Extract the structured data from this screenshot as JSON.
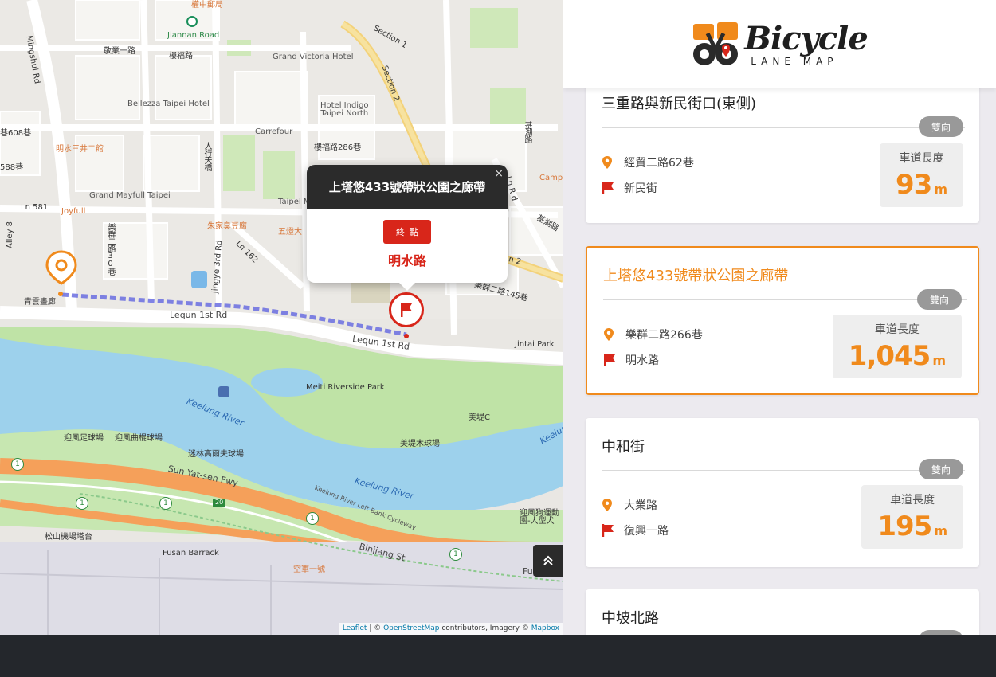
{
  "map": {
    "labels": {
      "jiannan_road": "Jiannan Road",
      "section_1": "Section 1",
      "section_2": "Section 2",
      "minghsui_rd": "Mingshui Rd",
      "jingye_1st": "敬業一路",
      "jingfu_rd": "樓福路",
      "grand_victoria": "Grand Victoria Hotel",
      "bellezza": "Bellezza Taipei Hotel",
      "hotel_indigo": "Hotel Indigo\nTaipei North",
      "carrefour": "Carrefour",
      "lane_286": "樓福路286巷",
      "jihu_rd": "基湖路",
      "ln_608": "巷608巷",
      "ln_588": "588巷",
      "mingshui_sanjing": "明水三井二館",
      "grand_mayfull": "Grand Mayfull Taipei",
      "joyfull": "Joyfull",
      "ln_581": "Ln 581",
      "alley_8": "Alley 8",
      "lequn_2nd_30": "樂群二路30巷",
      "jingye_3rd": "Jingye 3rd Rd",
      "renxing_st": "人行天橋",
      "zhujia": "朱家臭豆腐",
      "ln_162": "Ln 162",
      "wuyi": "五燈大",
      "taipei_m": "Taipei M",
      "camp": "Camp",
      "jihu_rd2": "基湖路",
      "lequn_2nd_145": "樂群二路145巷",
      "n2": "n 2",
      "jinjing_gallery": "青雲畫廊",
      "lequn_1st_a": "Lequn 1st Rd",
      "lequn_1st_b": "Lequn 1st Rd",
      "jintai_park": "Jintai Park",
      "meiti_park": "Meiti Riverside Park",
      "keelung_river_a": "Keelung River",
      "keelung_river_b": "Keelung River",
      "keelung_r": "Keelun",
      "meti_c": "美堤C",
      "meti_softball": "美堤木球場",
      "yingfeng_soccer": "迎風足球場",
      "yingfeng_hockey": "迎風曲棍球場",
      "mini_golf": "迷林高爾夫球場",
      "sun_yatsen_fwy": "Sun Yat-sen Fwy",
      "cycleway": "Keelung River Left Bank Cycleway",
      "songshan_tower": "松山機場塔台",
      "fusan_barrack": "Fusan Barrack",
      "binjiang_st": "Binjiang St",
      "fuyuan": "Fuyuan",
      "kongjun": "空軍一號",
      "dog_park": "迎風狗運動\n園-大型犬",
      "fwy_20": "20",
      "shield_1": "1"
    },
    "attribution": {
      "leaflet": "Leaflet",
      "sep": " | © ",
      "osm": "OpenStreetMap",
      "mid": " contributors, Imagery © ",
      "mapbox": "Mapbox"
    },
    "popup": {
      "title": "上塔悠433號帶狀公園之廊帶",
      "close": "×",
      "badge": "終點",
      "destination": "明水路"
    },
    "scroll_top_icon": "double-chevron-up-icon",
    "colors": {
      "route": "#6a6de0",
      "start": "#f08a1c",
      "end": "#d8261a"
    }
  },
  "logo": {
    "main": "Bicycle",
    "sub": "LANE MAP"
  },
  "cards": [
    {
      "title": "三重路與新民街口(東側)",
      "direction": "雙向",
      "start": "經貿二路62巷",
      "end": "新民街",
      "length_label": "車道長度",
      "length": "93",
      "unit": "m",
      "active": false
    },
    {
      "title": "上塔悠433號帶狀公園之廊帶",
      "direction": "雙向",
      "start": "樂群二路266巷",
      "end": "明水路",
      "length_label": "車道長度",
      "length": "1,045",
      "unit": "m",
      "active": true
    },
    {
      "title": "中和街",
      "direction": "雙向",
      "start": "大業路",
      "end": "復興一路",
      "length_label": "車道長度",
      "length": "195",
      "unit": "m",
      "active": false
    },
    {
      "title": "中坡北路",
      "active": false
    }
  ],
  "accent_color": "#f08a1c"
}
